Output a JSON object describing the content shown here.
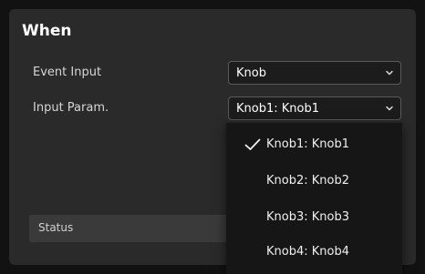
{
  "section": {
    "title": "When"
  },
  "rows": {
    "event_input": {
      "label": "Event Input",
      "value": "Knob"
    },
    "input_param": {
      "label": "Input Param.",
      "value": "Knob1: Knob1"
    }
  },
  "status": {
    "label": "Status"
  },
  "dropdown": {
    "selected_index": 0,
    "options": [
      "Knob1: Knob1",
      "Knob2: Knob2",
      "Knob3: Knob3",
      "Knob4: Knob4"
    ]
  },
  "colors": {
    "background": "#121212",
    "panel": "#2a2a2a",
    "dropdown": "#161616",
    "text": "#ffffff"
  },
  "icons": {
    "select_chevron": "chevron-down-icon",
    "selected_marker": "checkmark-icon"
  }
}
